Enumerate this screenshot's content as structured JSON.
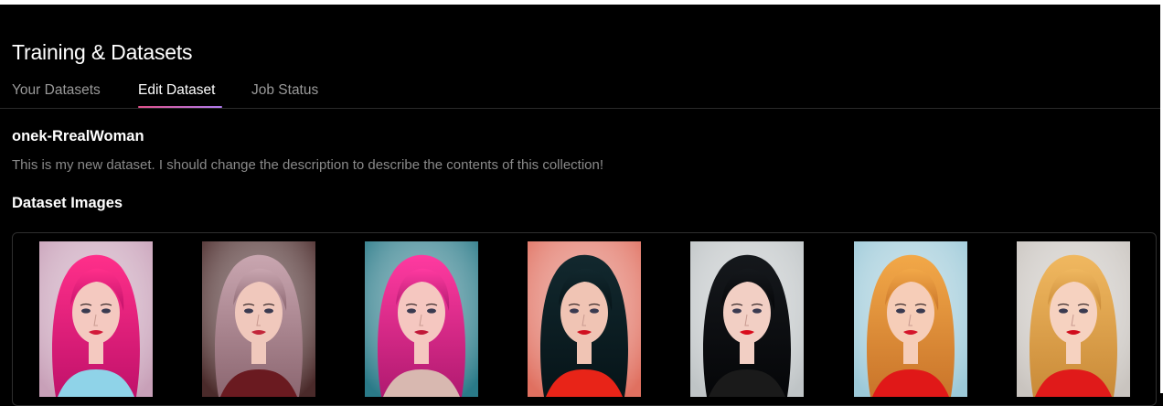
{
  "page": {
    "title": "Training & Datasets"
  },
  "tabs": [
    {
      "label": "Your Datasets",
      "active": false
    },
    {
      "label": "Edit Dataset",
      "active": true
    },
    {
      "label": "Job Status",
      "active": false
    }
  ],
  "dataset": {
    "name": "onek-RrealWoman",
    "description": "This is my new dataset. I should change the description to describe the contents of this collection!"
  },
  "images_section": {
    "title": "Dataset Images"
  },
  "images": [
    {
      "bg": "#c8a0b8",
      "hair": "#ff2f8a",
      "hair_dark": "#c0116a",
      "skin": "#f4c9c0",
      "lips": "#d21a3a",
      "outfit": "#8fd3e8"
    },
    {
      "bg": "#4a2a2a",
      "hair": "#c9a6b0",
      "hair_dark": "#8b6670",
      "skin": "#f0c8bc",
      "lips": "#c2263a",
      "outfit": "#6a1a20"
    },
    {
      "bg": "#2a7a88",
      "hair": "#ff3aa0",
      "hair_dark": "#b01a70",
      "skin": "#f5c7c0",
      "lips": "#c01838",
      "outfit": "#d8b8b0"
    },
    {
      "bg": "#e07060",
      "hair": "#12282e",
      "hair_dark": "#061418",
      "skin": "#f0c4b4",
      "lips": "#d01020",
      "outfit": "#e82418"
    },
    {
      "bg": "#bfc4c6",
      "hair": "#15181c",
      "hair_dark": "#050608",
      "skin": "#f2cfc4",
      "lips": "#d80c1c",
      "outfit": "#1a1a1a"
    },
    {
      "bg": "#9cc9d8",
      "hair": "#f2a848",
      "hair_dark": "#c9742a",
      "skin": "#f6cdb8",
      "lips": "#d4142a",
      "outfit": "#e01818"
    },
    {
      "bg": "#c9c4bf",
      "hair": "#f0b860",
      "hair_dark": "#c98a38",
      "skin": "#f6d2c0",
      "lips": "#d00c1c",
      "outfit": "#e01a1a"
    }
  ]
}
